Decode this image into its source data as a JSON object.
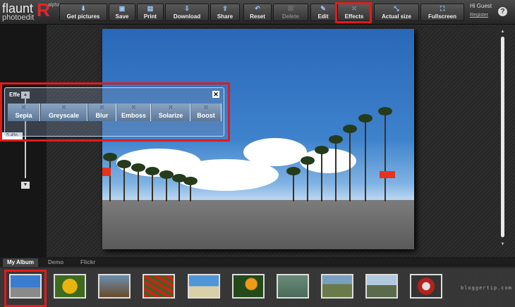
{
  "app": {
    "logo_word": "flaunt",
    "logo_letter": "R",
    "logo_sub": "photoedit",
    "logo_badge": "alpha"
  },
  "toolbar": [
    {
      "id": "get-pictures",
      "label": "Get pictures",
      "icon": "download-arrow-icon"
    },
    {
      "id": "save",
      "label": "Save",
      "icon": "floppy-disk-icon"
    },
    {
      "id": "print",
      "label": "Print",
      "icon": "printer-icon"
    },
    {
      "id": "download",
      "label": "Download",
      "icon": "download-icon"
    },
    {
      "id": "share",
      "label": "Share",
      "icon": "share-icon"
    },
    {
      "id": "reset",
      "label": "Reset",
      "icon": "undo-icon"
    },
    {
      "id": "delete",
      "label": "Delete",
      "icon": "close-box-icon",
      "disabled": true
    },
    {
      "id": "edit",
      "label": "Edit",
      "icon": "edit-icon"
    },
    {
      "id": "effects",
      "label": "Effects",
      "icon": "grid-dots-icon",
      "highlighted": true
    },
    {
      "id": "actual-size",
      "label": "Actual size",
      "icon": "resize-icon"
    },
    {
      "id": "fullscreen",
      "label": "Fullscreen",
      "icon": "expand-icon"
    }
  ],
  "user": {
    "greeting": "Hi Guest",
    "register": "Register",
    "help": "?"
  },
  "zoom": {
    "label": "5.4%"
  },
  "effects_panel": {
    "title": "Effects",
    "title_visible": "Effe",
    "buttons": [
      "Sepia",
      "Greyscale",
      "Blur",
      "Emboss",
      "Solarize",
      "Boost"
    ]
  },
  "album_tabs": [
    {
      "label": "My Album",
      "active": true
    },
    {
      "label": "Demo",
      "active": false
    },
    {
      "label": "Flickr",
      "active": false
    }
  ],
  "thumbnails": [
    "highway",
    "sunflower",
    "bench-scene",
    "chili-peppers",
    "beach",
    "bird-of-paradise",
    "ducks",
    "carriage",
    "street",
    "vintage-car"
  ],
  "watermark": "bloggertip.com",
  "colors": {
    "highlight": "#e21b1b",
    "accent": "#9ec8ff"
  }
}
